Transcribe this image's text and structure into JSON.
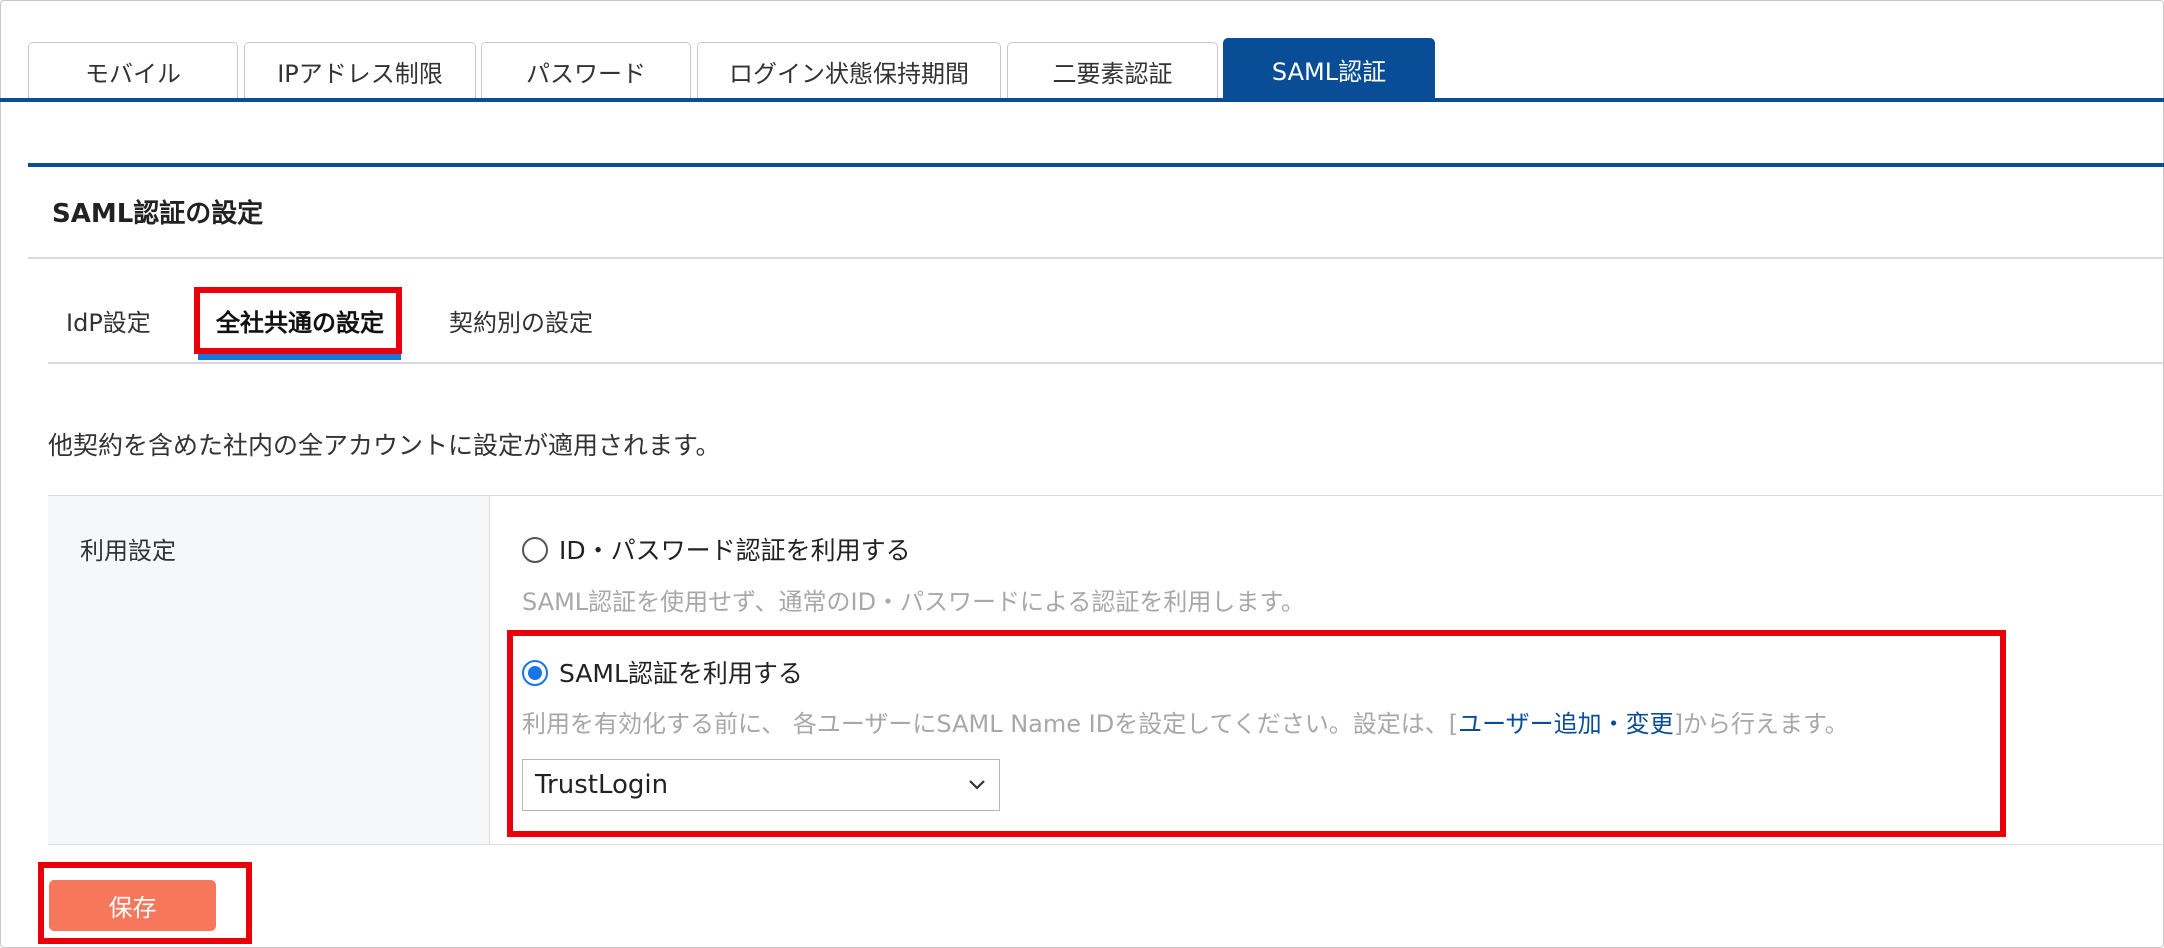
{
  "top_tabs": [
    {
      "label": "モバイル",
      "active": false
    },
    {
      "label": "IPアドレス制限",
      "active": false
    },
    {
      "label": "パスワード",
      "active": false
    },
    {
      "label": "ログイン状態保持期間",
      "active": false
    },
    {
      "label": "二要素認証",
      "active": false
    },
    {
      "label": "SAML認証",
      "active": true
    }
  ],
  "panel": {
    "title": "SAML認証の設定",
    "sub_tabs": [
      {
        "label": "IdP設定",
        "active": false
      },
      {
        "label": "全社共通の設定",
        "active": true
      },
      {
        "label": "契約別の設定",
        "active": false
      }
    ],
    "description": "他契約を含めた社内の全アカウントに設定が適用されます。"
  },
  "setting": {
    "label": "利用設定",
    "option_id": {
      "label": "ID・パスワード認証を利用する",
      "description": "SAML認証を使用せず、通常のID・パスワードによる認証を利用します。",
      "checked": false
    },
    "option_saml": {
      "label": "SAML認証を利用する",
      "desc_prefix": "利用を有効化する前に、 各ユーザーにSAML Name IDを設定してください。設定は、[",
      "desc_link": "ユーザー追加・変更",
      "desc_suffix": "]から行えます。",
      "checked": true
    },
    "idp_select": {
      "value": "TrustLogin"
    }
  },
  "save_button": {
    "label": "保存"
  },
  "colors": {
    "accent": "#0a4d97",
    "highlight": "#e8000a",
    "save": "#f6775b",
    "radio": "#1a73e8"
  }
}
